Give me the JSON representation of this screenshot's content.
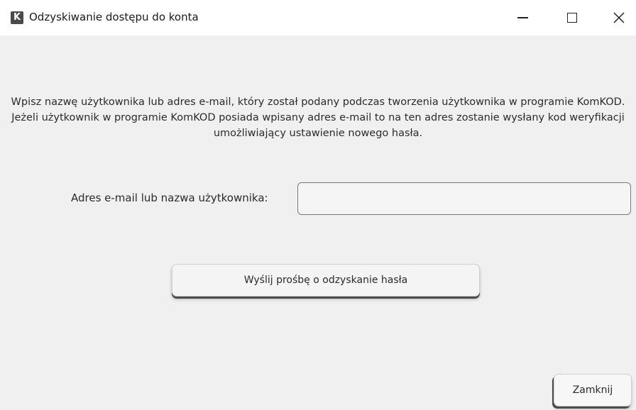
{
  "window": {
    "app_icon_letter": "K",
    "title": "Odzyskiwanie dostępu do konta"
  },
  "content": {
    "instructions": "Wpisz nazwę użytkownika lub adres e-mail, który został podany podczas tworzenia użytkownika w programie KomKOD. Jeżeli użytkownik w programie KomKOD posiada wpisany adres e-mail to na ten adres zostanie wysłany kod weryfikacji umożliwiający ustawienie nowego hasła.",
    "field_label": "Adres e-mail lub nazwa użytkownika:",
    "field_value": "",
    "send_button_label": "Wyślij prośbę o odzyskanie hasła",
    "close_button_label": "Zamknij"
  },
  "icons": {
    "minimize": "minimize-icon",
    "maximize": "maximize-icon",
    "close": "close-icon"
  },
  "colors": {
    "background": "#f0f0f0",
    "titlebar": "#ffffff",
    "app_icon": "#4a4a4a"
  }
}
